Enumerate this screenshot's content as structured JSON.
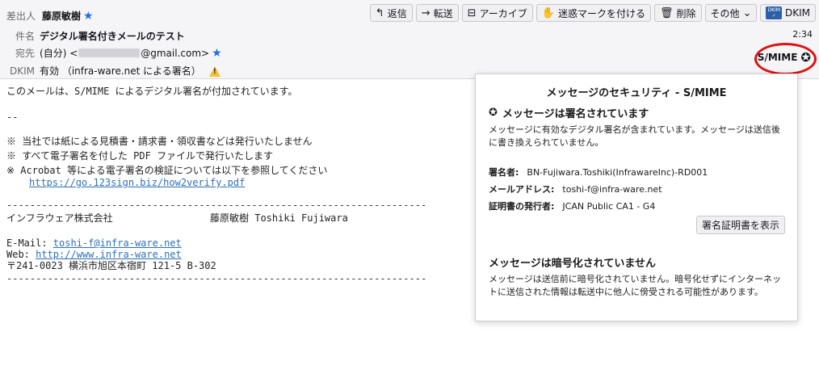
{
  "header": {
    "from_label": "差出人",
    "from_value": "藤原敏樹",
    "subject_label": "件名",
    "subject_value": "デジタル署名付きメールのテスト",
    "to_label": "宛先",
    "to_prefix": "(自分) <",
    "to_suffix": "@gmail.com>",
    "dkim_label": "DKIM",
    "dkim_value": "有効 （infra-ware.net による署名）",
    "time": "2:34",
    "smime_label": "S/MIME"
  },
  "toolbar": {
    "reply": "返信",
    "forward": "転送",
    "archive": "アーカイブ",
    "junk": "迷惑マークを付ける",
    "delete": "削除",
    "other": "その他",
    "dkim": "DKIM"
  },
  "body": {
    "line1": "このメールは、S/MIME によるデジタル署名が付加されています。",
    "dashes": "--",
    "note1": "※ 当社では紙による見積書・請求書・領収書などは発行いたしません",
    "note2": "※ すべて電子署名を付した PDF ファイルで発行いたします",
    "note3": "※ Acrobat 等による電子署名の検証については以下を参照してください",
    "verify_link": "https://go.123sign.biz/how2verify.pdf",
    "separator": "------------------------------------------------------------------------",
    "company": "インフラウェア株式会社",
    "person": "藤原敏樹 Toshiki Fujiwara",
    "email_label": "E-Mail: ",
    "email_link": "toshi-f@infra-ware.net",
    "web_label": "Web: ",
    "web_link": "http://www.infra-ware.net",
    "address": "〒241-0023 横浜市旭区本宿町 121-5 B-302"
  },
  "popup": {
    "title": "メッセージのセキュリティ - S/MIME",
    "signed_heading": "メッセージは署名されています",
    "signed_text": "メッセージに有効なデジタル署名が含まれています。メッセージは送信後に書き換えられていません。",
    "signer_label": "署名者:",
    "signer_value": "BN-Fujiwara.Toshiki(InfrawareInc)-RD001",
    "email_label": "メールアドレス:",
    "email_value": "toshi-f@infra-ware.net",
    "issuer_label": "証明書の発行者:",
    "issuer_value": "JCAN Public CA1 - G4",
    "cert_button": "署名証明書を表示",
    "enc_heading": "メッセージは暗号化されていません",
    "enc_text": "メッセージは送信前に暗号化されていません。暗号化せずにインターネットに送信された情報は転送中に他人に傍受される可能性があります。"
  },
  "colors": {
    "accent": "#1f6fe5",
    "link": "#2f6fb7",
    "highlight_ring": "#e01010",
    "warning": "#f2c12e"
  }
}
